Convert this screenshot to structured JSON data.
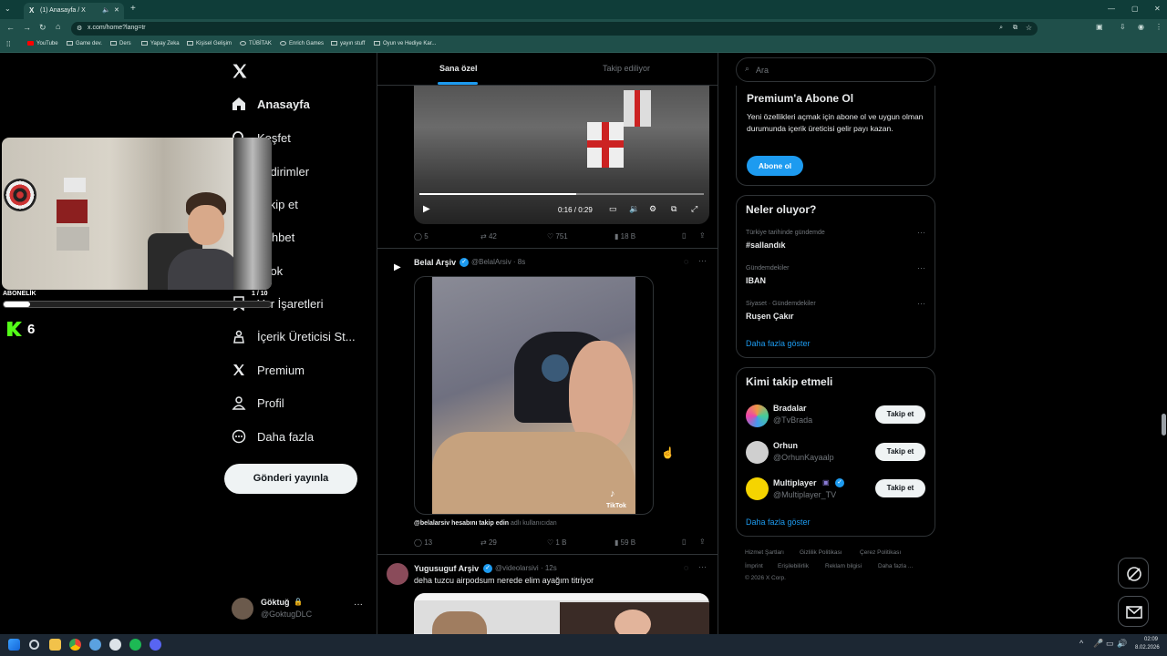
{
  "browser": {
    "tab_title": "(1) Anasayfa / X",
    "url": "x.com/home?lang=tr",
    "bookmarks": [
      "YouTube",
      "Game dev.",
      "Ders",
      "Yapay Zeka",
      "Kişisel Gelişim",
      "TÜBİTAK",
      "Enrich Games",
      "yayın stuff",
      "Oyun ve Hediye Kar..."
    ]
  },
  "nav": {
    "items": [
      {
        "label": "Anasayfa",
        "icon": "home-icon"
      },
      {
        "label": "Keşfet",
        "icon": "search-icon"
      },
      {
        "label": "Bildirimler",
        "icon": "bell-icon"
      },
      {
        "label": "Takip et",
        "icon": "person-plus-icon"
      },
      {
        "label": "Sohbet",
        "icon": "chat-icon"
      },
      {
        "label": "Grok",
        "icon": "grok-icon"
      },
      {
        "label": "Yer İşaretleri",
        "icon": "bookmark-icon"
      },
      {
        "label": "İçerik Üreticisi St...",
        "icon": "creator-icon"
      },
      {
        "label": "Premium",
        "icon": "x-logo-icon"
      },
      {
        "label": "Profil",
        "icon": "profile-icon"
      },
      {
        "label": "Daha fazla",
        "icon": "more-icon"
      }
    ],
    "post_button": "Gönderi yayınla",
    "account_name": "Göktuğ",
    "account_handle": "@GoktugDLC"
  },
  "overlay": {
    "sub_label": "ABONELİK",
    "sub_progress_text": "1 / 10",
    "sub_progress": 0.1,
    "kick_count": "6"
  },
  "timeline": {
    "tabs": [
      "Sana özel",
      "Takip ediliyor"
    ],
    "video1": {
      "time": "0:16 / 0:29",
      "progress": 0.55,
      "replies": "5",
      "reposts": "42",
      "likes": "751",
      "views": "18 B"
    },
    "post2": {
      "name": "Belal Arşiv",
      "handle": "@BelalArsiv",
      "time": "· 8s",
      "watermark": "TikTok",
      "caption_handle": "@belalarsiv hesabını takip edin",
      "caption_rest": " adlı kullanıcıdan",
      "replies": "13",
      "reposts": "29",
      "likes": "1 B",
      "views": "59 B"
    },
    "post3": {
      "name": "Yugusuguf Arşiv",
      "handle": "@videolarsivi",
      "time": "· 12s",
      "text": "deha tuzcu airpodsum nerede elim ayağım titriyor"
    }
  },
  "sidebar": {
    "search_placeholder": "Ara",
    "premium": {
      "title": "Premium'a Abone Ol",
      "body": "Yeni özellikleri açmak için abone ol ve uygun olman durumunda içerik üreticisi gelir payı kazan.",
      "button": "Abone ol"
    },
    "trends": {
      "title": "Neler oluyor?",
      "items": [
        {
          "context": "Türkiye tarihinde gündemde",
          "name": "#sallandık"
        },
        {
          "context": "Gündemdekiler",
          "name": "IBAN"
        },
        {
          "context": "Siyaset · Gündemdekiler",
          "name": "Ruşen Çakır"
        }
      ],
      "more": "Daha fazla göster"
    },
    "follow": {
      "title": "Kimi takip etmeli",
      "accounts": [
        {
          "name": "Bradalar",
          "handle": "@TvBrada",
          "button": "Takip et"
        },
        {
          "name": "Orhun",
          "handle": "@OrhunKayaalp",
          "button": "Takip et"
        },
        {
          "name": "Multiplayer",
          "handle": "@Multiplayer_TV",
          "button": "Takip et"
        }
      ],
      "more": "Daha fazla göster"
    },
    "footer": [
      "Hizmet Şartları",
      "Gizlilik Politikası",
      "Çerez Politikası",
      "İmprint",
      "Erişilebilirlik",
      "Reklam bilgisi",
      "Daha fazla ...",
      "© 2026 X Corp."
    ]
  },
  "taskbar": {
    "time": "02:09",
    "date": "8.02.2026"
  },
  "colors": {
    "accent": "#1d9bf0",
    "kick_green": "#53fc18",
    "chrome_teal": "#1f4f4a"
  }
}
